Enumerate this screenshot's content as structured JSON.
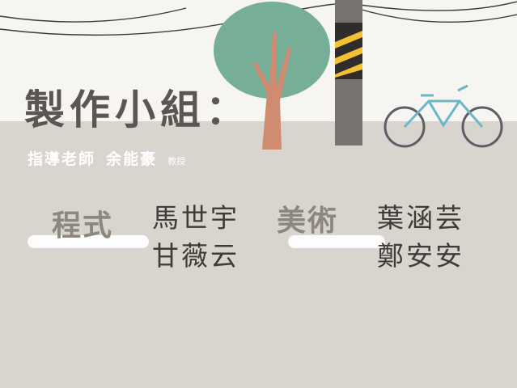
{
  "title": "製作小組：",
  "advisor": {
    "role": "指導老師",
    "name": "余能豪",
    "suffix": "教授"
  },
  "sections": [
    {
      "label": "程式",
      "members": [
        "馬世宇",
        "甘薇云"
      ]
    },
    {
      "label": "美術",
      "members": [
        "葉涵芸",
        "鄭安安"
      ]
    }
  ],
  "colors": {
    "ground": "#d9d4cd",
    "sky": "#f6f5f2",
    "title": "#5a5652",
    "tree_leaves": "#76ae98",
    "tree_trunk": "#d08c70",
    "pole": "#777371",
    "bike": "#6bb7c9"
  }
}
